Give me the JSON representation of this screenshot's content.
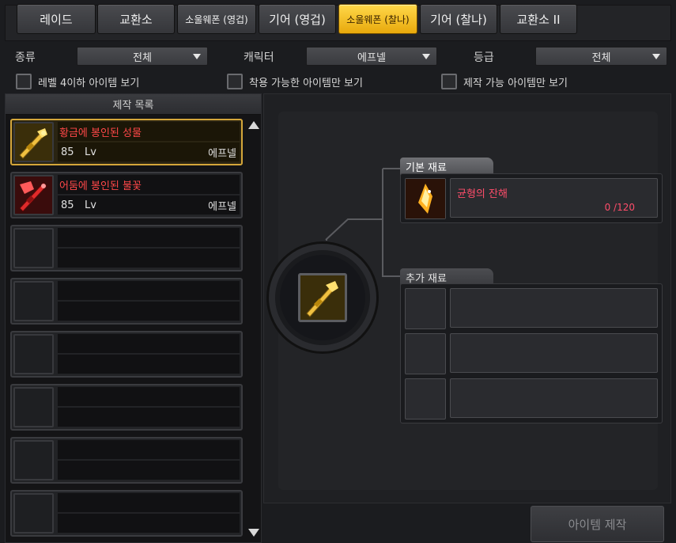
{
  "tabs": [
    {
      "label": "레이드"
    },
    {
      "label": "교환소"
    },
    {
      "label": "소울웨폰 (영겁)"
    },
    {
      "label": "기어 (영겁)"
    },
    {
      "label": "소울웨폰 (찰나)"
    },
    {
      "label": "기어 (찰나)"
    },
    {
      "label": "교환소 II"
    }
  ],
  "filters": {
    "type_label": "종류",
    "type_value": "전체",
    "char_label": "캐릭터",
    "char_value": "에프넬",
    "grade_label": "등급",
    "grade_value": "전체"
  },
  "checks": {
    "level": "레벨 4이하 아이템 보기",
    "wearable": "착용 가능한 아이템만 보기",
    "craftable": "제작 가능 아이템만 보기"
  },
  "list": {
    "header": "제작 목록",
    "items": [
      {
        "name": "황금에 봉인된 성물",
        "level": "85",
        "lv": "Lv",
        "character": "에프넬"
      },
      {
        "name": "어둠에 봉인된 불꽃",
        "level": "85",
        "lv": "Lv",
        "character": "에프넬"
      }
    ]
  },
  "materials": {
    "base_label": "기본 재료",
    "base_item": {
      "name": "균형의 잔해",
      "count": "0 /120"
    },
    "extra_label": "추가 재료"
  },
  "craft_button": "아이템 제작",
  "colors": {
    "accent": "#f2c12e",
    "item_name": "#ff4848",
    "material": "#ff4d6a"
  }
}
